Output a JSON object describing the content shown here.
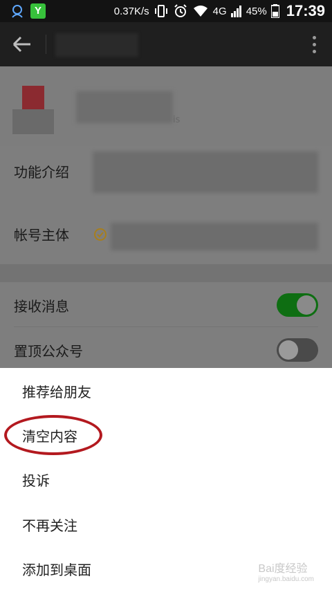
{
  "status_bar": {
    "speed": "0.37K/s",
    "network": "4G",
    "battery": "45%",
    "time": "17:39",
    "app_icon_letter": "Y"
  },
  "toolbar": {
    "back_icon": "arrow-left-icon",
    "more_icon": "more-vertical-icon"
  },
  "profile": {
    "sub_text": "is"
  },
  "info": {
    "intro_label": "功能介绍",
    "owner_label": "帐号主体"
  },
  "settings": {
    "receive_label": "接收消息",
    "receive_on": true,
    "pin_label": "置顶公众号",
    "pin_on": false
  },
  "sheet": {
    "items": [
      "推荐给朋友",
      "清空内容",
      "投诉",
      "不再关注",
      "添加到桌面"
    ],
    "highlighted_index": 1,
    "highlight_color": "#b3191f"
  },
  "watermark": {
    "text": "Bai度经验",
    "url": "jingyan.baidu.com"
  }
}
